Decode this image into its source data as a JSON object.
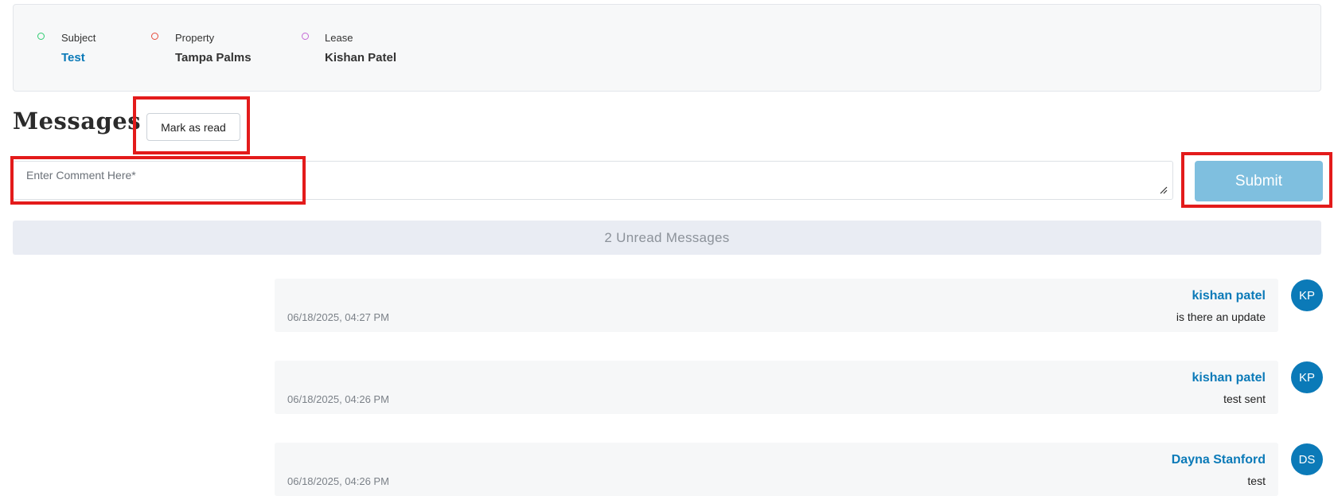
{
  "info": {
    "subject": {
      "label": "Subject",
      "value": "Test",
      "dot_color": "#2ecc71"
    },
    "property": {
      "label": "Property",
      "value": "Tampa Palms",
      "dot_color": "#e74c3c"
    },
    "lease": {
      "label": "Lease",
      "value": "Kishan Patel",
      "dot_color": "#c56cd6"
    }
  },
  "messages_title": "Messages",
  "mark_as_read_label": "Mark as read",
  "comment": {
    "placeholder": "Enter Comment Here*",
    "value": ""
  },
  "submit_label": "Submit",
  "unread_label": "2 Unread Messages",
  "messages": [
    {
      "author": "kishan patel",
      "time": "06/18/2025, 04:27 PM",
      "text": "is there an update",
      "initials": "KP"
    },
    {
      "author": "kishan patel",
      "time": "06/18/2025, 04:26 PM",
      "text": "test sent",
      "initials": "KP"
    },
    {
      "author": "Dayna Stanford",
      "time": "06/18/2025, 04:26 PM",
      "text": "test",
      "initials": "DS"
    }
  ],
  "colors": {
    "accent": "#0b7ab8",
    "submit": "#7fbfdf",
    "highlight": "#e31b1b"
  }
}
